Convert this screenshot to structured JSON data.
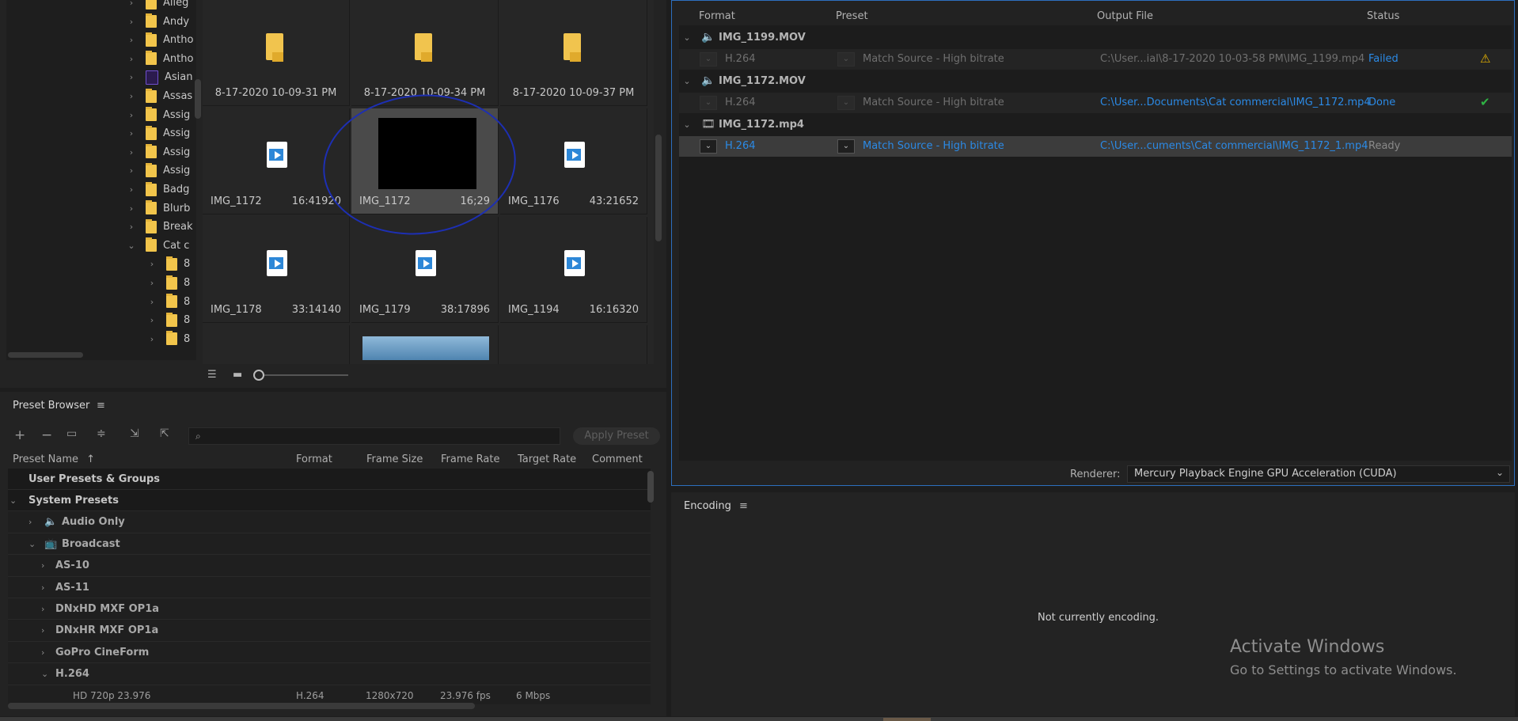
{
  "media_browser": {
    "tree_items": [
      {
        "label": "Alleg",
        "icon": "folder-icon",
        "expand": "collapsed"
      },
      {
        "label": "Andy",
        "icon": "folder-icon",
        "expand": "collapsed"
      },
      {
        "label": "Antho",
        "icon": "folder-icon",
        "expand": "collapsed"
      },
      {
        "label": "Antho",
        "icon": "folder-icon",
        "expand": "collapsed"
      },
      {
        "label": "Asian",
        "icon": "after-effects-file-icon",
        "expand": "collapsed"
      },
      {
        "label": "Assas",
        "icon": "folder-icon",
        "expand": "collapsed"
      },
      {
        "label": "Assig",
        "icon": "folder-icon",
        "expand": "collapsed"
      },
      {
        "label": "Assig",
        "icon": "folder-icon",
        "expand": "collapsed"
      },
      {
        "label": "Assig",
        "icon": "folder-icon",
        "expand": "collapsed"
      },
      {
        "label": "Assig",
        "icon": "folder-icon",
        "expand": "collapsed"
      },
      {
        "label": "Badg",
        "icon": "folder-icon",
        "expand": "collapsed"
      },
      {
        "label": "Blurb",
        "icon": "folder-icon",
        "expand": "collapsed"
      },
      {
        "label": "Break",
        "icon": "folder-icon",
        "expand": "collapsed"
      },
      {
        "label": "Cat c",
        "icon": "folder-icon",
        "expand": "expanded"
      },
      {
        "label": "8",
        "icon": "folder-icon",
        "expand": "collapsed"
      },
      {
        "label": "8",
        "icon": "folder-icon",
        "expand": "collapsed"
      },
      {
        "label": "8",
        "icon": "folder-icon",
        "expand": "collapsed"
      },
      {
        "label": "8",
        "icon": "folder-icon",
        "expand": "collapsed"
      },
      {
        "label": "8",
        "icon": "folder-icon",
        "expand": "collapsed"
      }
    ],
    "thumbnails": [
      {
        "name": "8-17-2020 10-09-31 PM",
        "duration": "",
        "kind": "folder"
      },
      {
        "name": "8-17-2020 10-09-34 PM",
        "duration": "",
        "kind": "folder"
      },
      {
        "name": "8-17-2020 10-09-37 PM",
        "duration": "",
        "kind": "folder"
      },
      {
        "name": "IMG_1172",
        "duration": "16:41920",
        "kind": "video"
      },
      {
        "name": "IMG_1172",
        "duration": "16;29",
        "kind": "thumbnail-selected"
      },
      {
        "name": "IMG_1176",
        "duration": "43:21652",
        "kind": "video"
      },
      {
        "name": "IMG_1178",
        "duration": "33:14140",
        "kind": "video"
      },
      {
        "name": "IMG_1179",
        "duration": "38:17896",
        "kind": "video"
      },
      {
        "name": "IMG_1194",
        "duration": "16:16320",
        "kind": "video"
      }
    ],
    "view_icons": [
      "list-view-icon",
      "thumbnail-view-icon"
    ],
    "annotation_color": "#1d2fb3"
  },
  "preset_browser": {
    "title": "Preset Browser",
    "menu_icon": "hamburger-icon",
    "toolbar_icons": [
      "add-preset-icon",
      "remove-preset-icon",
      "new-group-icon",
      "preset-settings-icon",
      "import-preset-icon",
      "export-preset-icon"
    ],
    "search_icon": "search-icon",
    "search_placeholder": "",
    "apply_label": "Apply Preset",
    "columns": [
      "Preset Name",
      "Format",
      "Frame Size",
      "Frame Rate",
      "Target Rate",
      "Comment"
    ],
    "sort_indicator": "↑",
    "rows": [
      {
        "label": "User Presets & Groups",
        "level": 0,
        "kind": "header",
        "expand": "none"
      },
      {
        "label": "System Presets",
        "level": 0,
        "kind": "header",
        "expand": "expanded"
      },
      {
        "label": "Audio Only",
        "level": 1,
        "kind": "category",
        "icon": "speaker-icon",
        "expand": "collapsed"
      },
      {
        "label": "Broadcast",
        "level": 1,
        "kind": "category",
        "icon": "tv-icon",
        "expand": "expanded"
      },
      {
        "label": "AS-10",
        "level": 2,
        "kind": "group",
        "expand": "collapsed"
      },
      {
        "label": "AS-11",
        "level": 2,
        "kind": "group",
        "expand": "collapsed"
      },
      {
        "label": "DNxHD MXF OP1a",
        "level": 2,
        "kind": "group",
        "expand": "collapsed"
      },
      {
        "label": "DNxHR MXF OP1a",
        "level": 2,
        "kind": "group",
        "expand": "collapsed"
      },
      {
        "label": "GoPro CineForm",
        "level": 2,
        "kind": "group",
        "expand": "collapsed"
      },
      {
        "label": "H.264",
        "level": 2,
        "kind": "group",
        "expand": "expanded"
      },
      {
        "label": "HD 720p 23.976",
        "level": 3,
        "kind": "preset",
        "expand": "none",
        "format": "H.264",
        "frame_size": "1280x720",
        "frame_rate": "23.976 fps",
        "target_rate": "6 Mbps"
      }
    ]
  },
  "queue": {
    "columns": [
      "Format",
      "Preset",
      "Output File",
      "Status"
    ],
    "items": [
      {
        "source": "IMG_1199.MOV",
        "source_icon": "speaker-icon",
        "format": "H.264",
        "preset": "Match Source - High bitrate",
        "output": "C:\\User...ial\\8-17-2020 10-03-58 PM\\IMG_1199.mp4",
        "status": "Failed",
        "status_icon": "warning-icon",
        "state": "failed"
      },
      {
        "source": "IMG_1172.MOV",
        "source_icon": "speaker-icon",
        "format": "H.264",
        "preset": "Match Source - High bitrate",
        "output": "C:\\User...Documents\\Cat commercial\\IMG_1172.mp4",
        "status": "Done",
        "status_icon": "checkmark-icon",
        "state": "done"
      },
      {
        "source": "IMG_1172.mp4",
        "source_icon": "film-icon",
        "format": "H.264",
        "preset": "Match Source - High bitrate",
        "output": "C:\\User...cuments\\Cat commercial\\IMG_1172_1.mp4",
        "status": "Ready",
        "status_icon": "",
        "state": "ready"
      }
    ],
    "renderer_label": "Renderer:",
    "renderer_value": "Mercury Playback Engine GPU Acceleration (CUDA)",
    "accent_color": "#2d6fbf",
    "link_color": "#2b8ae6",
    "warning_color": "#e8b400",
    "success_color": "#2fb344"
  },
  "encoding": {
    "title": "Encoding",
    "status": "Not currently encoding."
  },
  "watermark": {
    "line1": "Activate Windows",
    "line2": "Go to Settings to activate Windows."
  }
}
